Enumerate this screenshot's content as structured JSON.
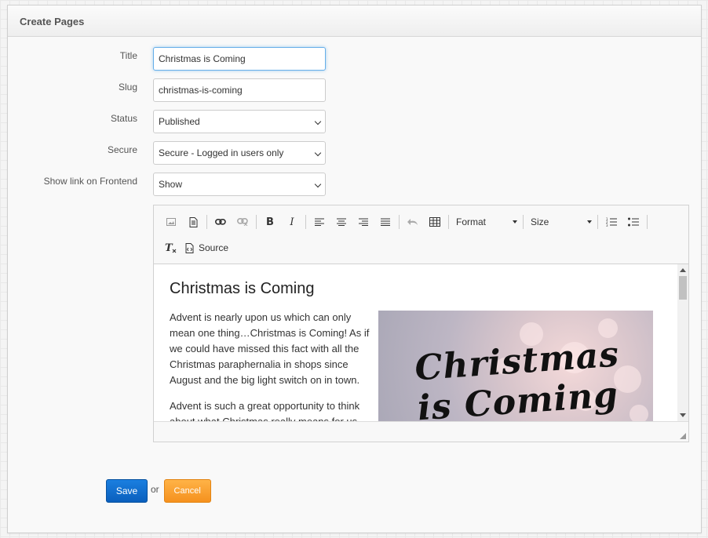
{
  "panel": {
    "title": "Create Pages"
  },
  "form": {
    "title": {
      "label": "Title",
      "value": "Christmas is Coming"
    },
    "slug": {
      "label": "Slug",
      "value": "christmas-is-coming"
    },
    "status": {
      "label": "Status",
      "value": "Published"
    },
    "secure": {
      "label": "Secure",
      "value": "Secure - Logged in users only"
    },
    "show_link": {
      "label": "Show link on Frontend",
      "value": "Show"
    }
  },
  "editor": {
    "toolbar": {
      "format_label": "Format",
      "size_label": "Size",
      "source_label": "Source",
      "bold": "B",
      "italic": "I"
    },
    "content": {
      "heading": "Christmas is Coming",
      "paragraph1": "Advent is nearly upon us which can only mean one thing…Christmas is Coming! As if we could have missed this fact with all the Christmas paraphernalia in shops since August and the big light switch on in town.",
      "paragraph2": "Advent is such a great opportunity to think about what Christmas really means for us",
      "image_text": "Christmas is Coming"
    }
  },
  "actions": {
    "save_label": "Save",
    "or_label": "or",
    "cancel_label": "Cancel"
  }
}
